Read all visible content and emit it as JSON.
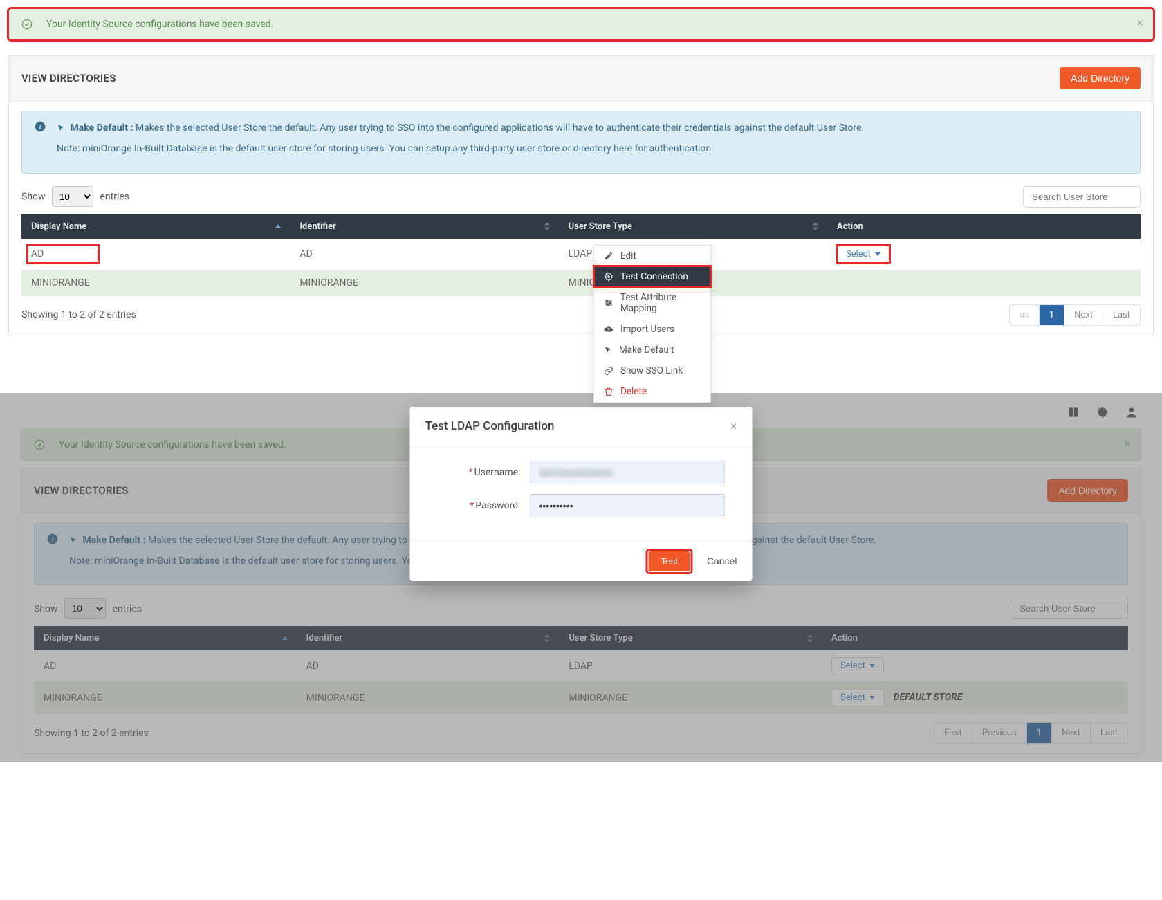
{
  "alert_text": "Your Identity Source configurations have been saved.",
  "panel_title": "VIEW DIRECTORIES",
  "add_directory": "Add Directory",
  "info": {
    "make_default_label": "Make Default :",
    "make_default_text": " Makes the selected User Store the default. Any user trying to SSO into the configured applications will have to authenticate their credentials against the default User Store.",
    "note_text": "Note: miniOrange In-Built Database is the default user store for storing users. You can setup any third-party user store or directory here for authentication."
  },
  "table_controls": {
    "show": "Show",
    "entries": "entries",
    "page_size": "10",
    "search_placeholder": "Search User Store"
  },
  "columns": {
    "display_name": "Display Name",
    "identifier": "Identifier",
    "user_store_type": "User Store Type",
    "action": "Action"
  },
  "rows": [
    {
      "display_name": "AD",
      "identifier": "AD",
      "user_store_type": "LDAP"
    },
    {
      "display_name": "MINIORANGE",
      "identifier": "MINIORANGE",
      "user_store_type": "MINIORANGE"
    }
  ],
  "select_label": "Select",
  "default_store_label": "DEFAULT STORE",
  "dropdown": {
    "edit": "Edit",
    "test_connection": "Test Connection",
    "test_attr_mapping": "Test Attribute Mapping",
    "import_users": "Import Users",
    "make_default": "Make Default",
    "show_sso_link": "Show SSO Link",
    "delete": "Delete"
  },
  "footer_text": "Showing 1 to 2 of 2 entries",
  "pager": {
    "first": "First",
    "previous": "Previous",
    "page": "1",
    "next": "Next",
    "last": "Last"
  },
  "modal": {
    "title": "Test LDAP Configuration",
    "username_label": "Username:",
    "password_label": "Password:",
    "username_value": "serviceusername",
    "password_value": "••••••••••",
    "test": "Test",
    "cancel": "Cancel"
  },
  "pager2": {
    "previous_trunc": "us"
  }
}
